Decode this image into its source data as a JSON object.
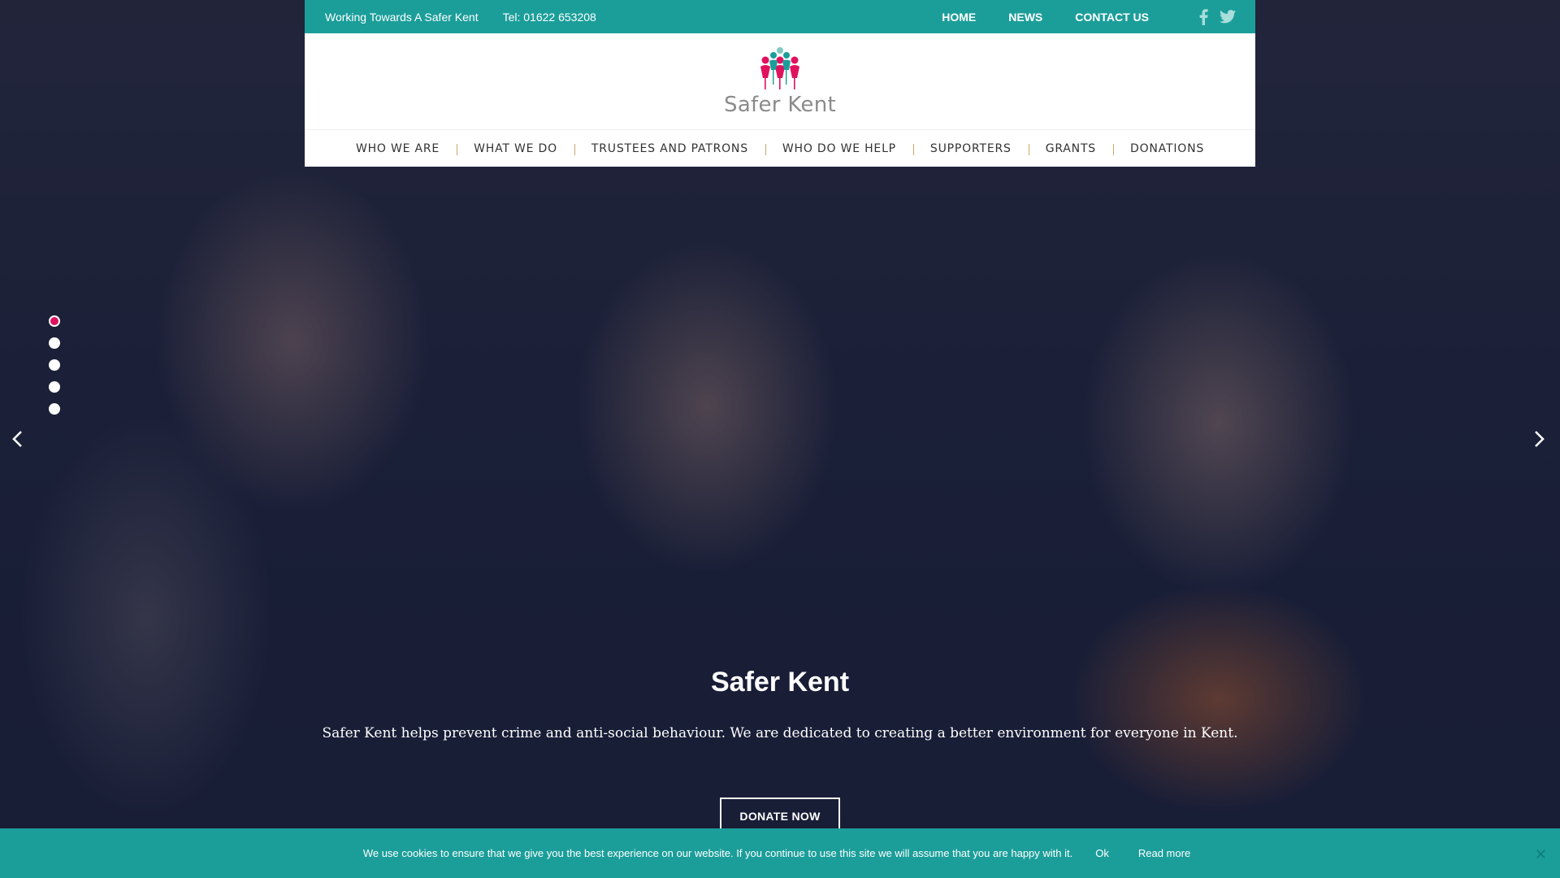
{
  "topbar": {
    "tagline": "Working Towards A Safer Kent",
    "phone": "Tel: 01622 653208",
    "nav": [
      "HOME",
      "NEWS",
      "CONTACT US"
    ],
    "social_icons": [
      "facebook-icon",
      "twitter-icon"
    ]
  },
  "header": {
    "logo_text": "Safer Kent"
  },
  "mainnav": {
    "items": [
      "WHO WE ARE",
      "WHAT WE DO",
      "TRUSTEES AND PATRONS",
      "WHO DO WE HELP",
      "SUPPORTERS",
      "GRANTS",
      "DONATIONS"
    ]
  },
  "slider": {
    "active_index": 0,
    "dot_count": 5,
    "title": "Safer Kent",
    "text": "Safer Kent helps prevent crime and anti-social behaviour. We are dedicated to creating a better environment for everyone in Kent.",
    "cta": "DONATE NOW",
    "prev_icon": "chevron-left-icon",
    "next_icon": "chevron-right-icon"
  },
  "cookie": {
    "message": "We use cookies to ensure that we give you the best experience on our website. If you continue to use this site we will assume that you are happy with it.",
    "ok_label": "Ok",
    "read_more_label": "Read more",
    "close_icon": "close-icon"
  },
  "colors": {
    "teal": "#1b9e9a",
    "pink": "#e0115f",
    "nav_divider": "#c9a66b"
  }
}
